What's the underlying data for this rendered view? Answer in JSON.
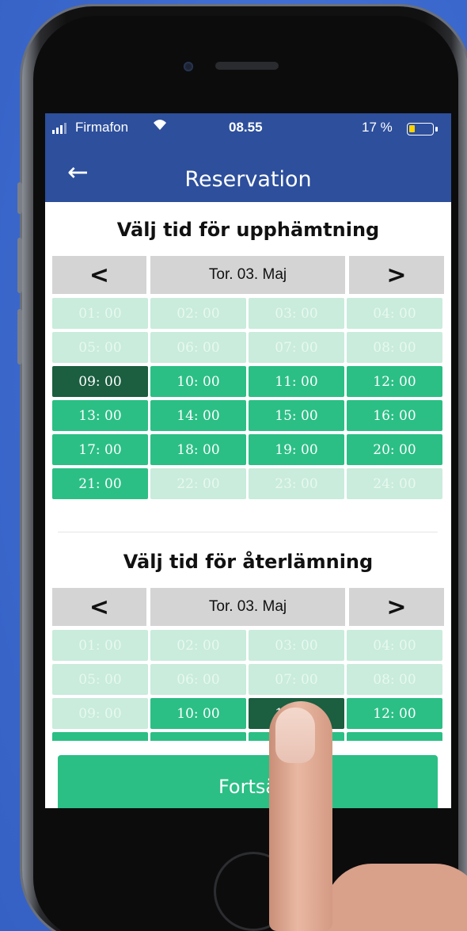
{
  "status_bar": {
    "carrier": "Firmafon",
    "time": "08.55",
    "battery_percent": "17 %",
    "battery_level": 0.17
  },
  "nav": {
    "back_icon": "arrow-left-icon",
    "back_glyph": "←",
    "title": "Reservation"
  },
  "pickup": {
    "title": "Välj tid för upphämtning",
    "date": "Tor. 03. Maj",
    "prev_glyph": "<",
    "next_glyph": ">",
    "slots": [
      {
        "label": "01: 00",
        "state": "disabled"
      },
      {
        "label": "02: 00",
        "state": "disabled"
      },
      {
        "label": "03: 00",
        "state": "disabled"
      },
      {
        "label": "04: 00",
        "state": "disabled"
      },
      {
        "label": "05: 00",
        "state": "disabled"
      },
      {
        "label": "06: 00",
        "state": "disabled"
      },
      {
        "label": "07: 00",
        "state": "disabled"
      },
      {
        "label": "08: 00",
        "state": "disabled"
      },
      {
        "label": "09: 00",
        "state": "selected"
      },
      {
        "label": "10: 00",
        "state": "available"
      },
      {
        "label": "11: 00",
        "state": "available"
      },
      {
        "label": "12: 00",
        "state": "available"
      },
      {
        "label": "13: 00",
        "state": "available"
      },
      {
        "label": "14: 00",
        "state": "available"
      },
      {
        "label": "15: 00",
        "state": "available"
      },
      {
        "label": "16: 00",
        "state": "available"
      },
      {
        "label": "17: 00",
        "state": "available"
      },
      {
        "label": "18: 00",
        "state": "available"
      },
      {
        "label": "19: 00",
        "state": "available"
      },
      {
        "label": "20: 00",
        "state": "available"
      },
      {
        "label": "21: 00",
        "state": "available"
      },
      {
        "label": "22: 00",
        "state": "disabled"
      },
      {
        "label": "23: 00",
        "state": "disabled"
      },
      {
        "label": "24: 00",
        "state": "disabled"
      }
    ]
  },
  "return": {
    "title": "Välj tid för återlämning",
    "date": "Tor. 03. Maj",
    "prev_glyph": "<",
    "next_glyph": ">",
    "slots": [
      {
        "label": "01: 00",
        "state": "disabled"
      },
      {
        "label": "02: 00",
        "state": "disabled"
      },
      {
        "label": "03: 00",
        "state": "disabled"
      },
      {
        "label": "04: 00",
        "state": "disabled"
      },
      {
        "label": "05: 00",
        "state": "disabled"
      },
      {
        "label": "06: 00",
        "state": "disabled"
      },
      {
        "label": "07: 00",
        "state": "disabled"
      },
      {
        "label": "08: 00",
        "state": "disabled"
      },
      {
        "label": "09: 00",
        "state": "disabled"
      },
      {
        "label": "10: 00",
        "state": "available"
      },
      {
        "label": "11: 00",
        "state": "selected"
      },
      {
        "label": "12: 00",
        "state": "available"
      },
      {
        "label": "",
        "state": "available"
      },
      {
        "label": "",
        "state": "available"
      },
      {
        "label": "",
        "state": "available"
      },
      {
        "label": "",
        "state": "available"
      }
    ]
  },
  "continue_button": {
    "label": "Fortsä"
  },
  "colors": {
    "nav_blue": "#2d4f9c",
    "slot_available": "#2bbf85",
    "slot_selected": "#1b5e40",
    "slot_disabled": "#c9ecdc",
    "background": "#3f6ed3"
  }
}
